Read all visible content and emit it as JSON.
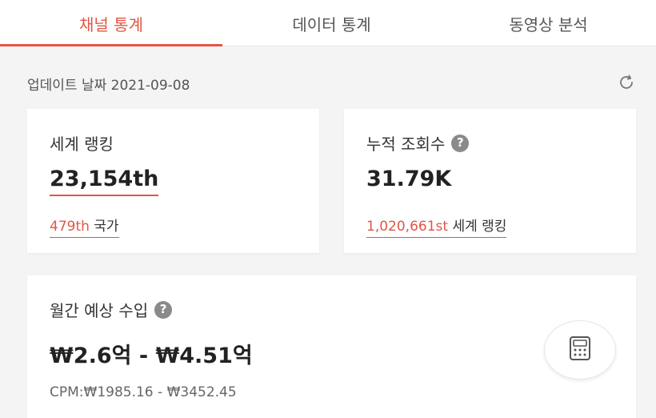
{
  "tabs": [
    {
      "label": "채널 통계",
      "active": true
    },
    {
      "label": "데이터 통계",
      "active": false
    },
    {
      "label": "동영상 분석",
      "active": false
    }
  ],
  "update": {
    "label": "업데이트 날짜 2021-09-08"
  },
  "cards": {
    "world_rank": {
      "label": "세계 랭킹",
      "value": "23,154th",
      "sub_value": "479th",
      "sub_suffix": "국가"
    },
    "total_views": {
      "label": "누적 조회수",
      "help": "?",
      "value": "31.79K",
      "sub_value": "1,020,661st",
      "sub_suffix": "세계 랭킹"
    },
    "monthly_income": {
      "label": "월간 예상 수입",
      "help": "?",
      "value": "₩2.6억 - ₩4.51억",
      "cpm": "CPM:₩1985.16 - ₩3452.45"
    }
  },
  "colors": {
    "accent": "#e35545",
    "background": "#f4f4f4",
    "card": "#ffffff"
  },
  "icons": {
    "refresh": "refresh-icon",
    "help": "help-icon",
    "calculator": "calculator-icon"
  }
}
